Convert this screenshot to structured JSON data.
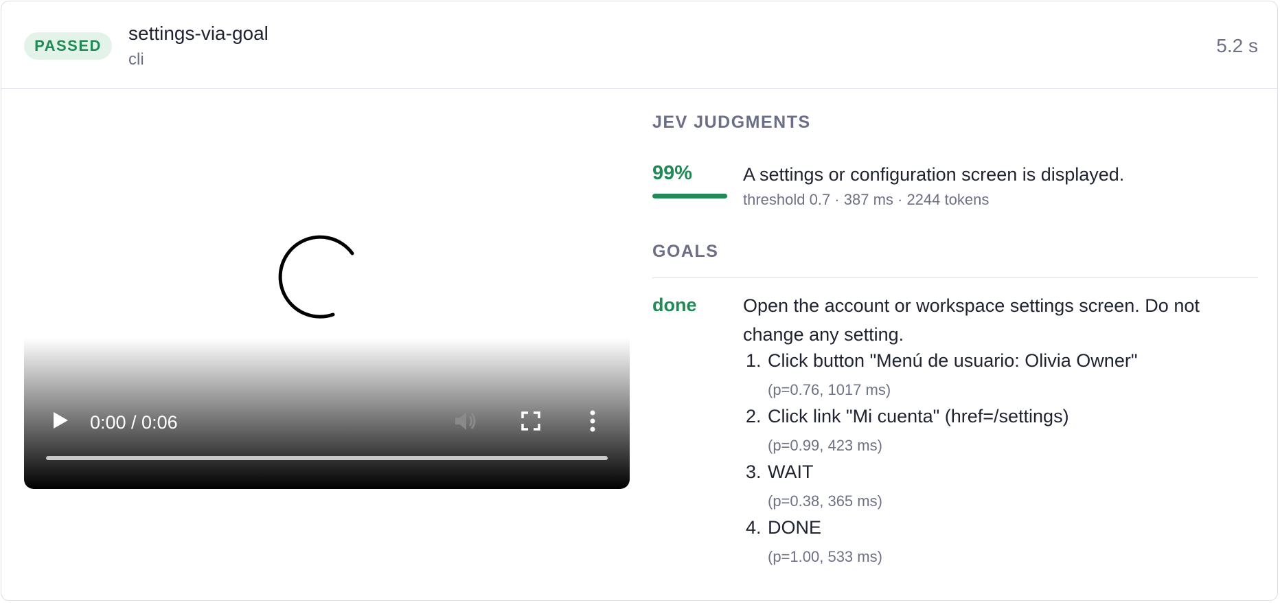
{
  "header": {
    "status_badge": "PASSED",
    "title": "settings-via-goal",
    "subtitle": "cli",
    "duration": "5.2 s"
  },
  "video": {
    "time_display": "0:00 / 0:06",
    "played_fraction": 0
  },
  "judgments": {
    "section_title": "JEV JUDGMENTS",
    "items": [
      {
        "score": "99%",
        "score_fraction": 0.99,
        "text": "A settings or configuration screen is displayed.",
        "meta": "threshold 0.7 · 387 ms · 2244 tokens"
      }
    ]
  },
  "goals": {
    "section_title": "GOALS",
    "items": [
      {
        "status": "done",
        "text": "Open the account or workspace settings screen. Do not change any setting.",
        "steps": [
          {
            "num": "1.",
            "text": "Click button \"Menú de usuario: Olivia Owner\"",
            "meta": "(p=0.76, 1017 ms)"
          },
          {
            "num": "2.",
            "text": "Click link \"Mi cuenta\" (href=/settings)",
            "meta": "(p=0.99, 423 ms)"
          },
          {
            "num": "3.",
            "text": "WAIT",
            "meta": "(p=0.38, 365 ms)"
          },
          {
            "num": "4.",
            "text": "DONE",
            "meta": "(p=1.00, 533 ms)"
          }
        ]
      }
    ]
  },
  "colors": {
    "pass_green": "#1f8a55",
    "badge_bg": "#e4f3ea",
    "muted_text": "#6e7185",
    "section_heading": "#6b6e86",
    "border": "#dcdde6"
  },
  "icons": [
    "play-icon",
    "volume-muted-icon",
    "fullscreen-icon",
    "more-options-icon",
    "loading-spinner-icon"
  ]
}
